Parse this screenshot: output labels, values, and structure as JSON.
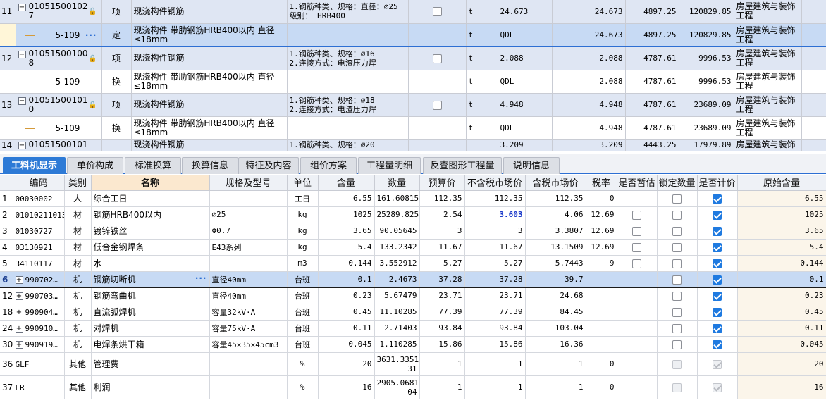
{
  "top_rows": [
    {
      "num": "11",
      "type": "parent",
      "code": "01051500102",
      "code2": "7",
      "kind": "项",
      "name": "现浇构件钢筋",
      "name2": "",
      "feat1": "1.钢筋种类、规格：直径：⌀25",
      "feat2": "级别： HRB400",
      "unit": "t",
      "expr": "24.673",
      "qty": "24.673",
      "price": "4897.25",
      "total": "120829.85",
      "prof1": "房屋建筑与装饰",
      "prof2": "工程"
    },
    {
      "num": "",
      "type": "child",
      "selected": true,
      "code": "5-109",
      "kind": "定",
      "name": "现浇构件 带肋钢筋HRB400以内 直径",
      "name2": "≤18mm",
      "feat1": "",
      "feat2": "",
      "unit": "t",
      "expr": "QDL",
      "qty": "24.673",
      "price": "4897.25",
      "total": "120829.85",
      "prof1": "房屋建筑与装饰",
      "prof2": "工程"
    },
    {
      "num": "12",
      "type": "parent",
      "code": "01051500100",
      "code2": "8",
      "kind": "项",
      "name": "现浇构件钢筋",
      "name2": "",
      "feat1": "1.钢筋种类、规格：⌀16",
      "feat2": "2.连接方式：电渣压力焊",
      "unit": "t",
      "expr": "2.088",
      "qty": "2.088",
      "price": "4787.61",
      "total": "9996.53",
      "prof1": "房屋建筑与装饰",
      "prof2": "工程"
    },
    {
      "num": "",
      "type": "child",
      "code": "5-109",
      "kind": "换",
      "name": "现浇构件 带肋钢筋HRB400以内 直径",
      "name2": "≤18mm",
      "feat1": "",
      "feat2": "",
      "unit": "t",
      "expr": "QDL",
      "qty": "2.088",
      "price": "4787.61",
      "total": "9996.53",
      "prof1": "房屋建筑与装饰",
      "prof2": "工程"
    },
    {
      "num": "13",
      "type": "parent",
      "code": "01051500101",
      "code2": "0",
      "kind": "项",
      "name": "现浇构件钢筋",
      "name2": "",
      "feat1": "1.钢筋种类、规格：⌀18",
      "feat2": "2.连接方式：电渣压力焊",
      "unit": "t",
      "expr": "4.948",
      "qty": "4.948",
      "price": "4787.61",
      "total": "23689.09",
      "prof1": "房屋建筑与装饰",
      "prof2": "工程"
    },
    {
      "num": "",
      "type": "child",
      "code": "5-109",
      "kind": "换",
      "name": "现浇构件 带肋钢筋HRB400以内 直径",
      "name2": "≤18mm",
      "feat1": "",
      "feat2": "",
      "unit": "t",
      "expr": "QDL",
      "qty": "4.948",
      "price": "4787.61",
      "total": "23689.09",
      "prof1": "房屋建筑与装饰",
      "prof2": "工程"
    },
    {
      "num": "14",
      "type": "parent",
      "partial": true,
      "code": "01051500101",
      "code2": "",
      "kind": "",
      "name": "现浇构件钢筋",
      "name2": "",
      "feat1": "1.钢筋种类、规格：⌀20",
      "feat2": "",
      "unit": "",
      "expr": "3.209",
      "qty": "3.209",
      "price": "4443.25",
      "total": "17979.89",
      "prof1": "房屋建筑与装饰",
      "prof2": ""
    }
  ],
  "tabs": [
    {
      "label": "工料机显示",
      "active": true
    },
    {
      "label": "单价构成"
    },
    {
      "label": "标准换算"
    },
    {
      "label": "换算信息"
    },
    {
      "label": "特征及内容"
    },
    {
      "label": "组价方案"
    },
    {
      "label": "工程量明细"
    },
    {
      "label": "反查图形工程量"
    },
    {
      "label": "说明信息"
    }
  ],
  "columns": [
    "",
    "编码",
    "类别",
    "名称",
    "规格及型号",
    "单位",
    "含量",
    "数量",
    "预算价",
    "不含税市场价",
    "含税市场价",
    "税率",
    "是否暂估",
    "锁定数量",
    "是否计价",
    "原始含量"
  ],
  "materials": [
    {
      "rn": "1",
      "code": "00030002",
      "cat": "人",
      "name": "综合工日",
      "spec": "",
      "unit": "工日",
      "content": "6.55",
      "qty": "161.60815",
      "budget": "112.35",
      "market": "112.35",
      "tax_market": "112.35",
      "rate": "0",
      "est": "none",
      "lock": "box",
      "priced": "checked",
      "orig": "6.55"
    },
    {
      "rn": "2",
      "code": "01010211013",
      "cat": "材",
      "name": "钢筋HRB400以内",
      "spec": "⌀25",
      "unit": "kg",
      "content": "1025",
      "qty": "25289.825",
      "budget": "2.54",
      "market": "3.603",
      "market_blue": true,
      "tax_market": "4.06",
      "rate": "12.69",
      "est": "box",
      "lock": "box",
      "priced": "checked",
      "orig": "1025"
    },
    {
      "rn": "3",
      "code": "01030727",
      "cat": "材",
      "name": "镀锌铁丝",
      "spec": "Φ0.7",
      "unit": "kg",
      "content": "3.65",
      "qty": "90.05645",
      "budget": "3",
      "market": "3",
      "tax_market": "3.3807",
      "rate": "12.69",
      "est": "box",
      "lock": "box",
      "priced": "checked",
      "orig": "3.65"
    },
    {
      "rn": "4",
      "code": "03130921",
      "cat": "材",
      "name": "低合金钢焊条",
      "spec": "E43系列",
      "unit": "kg",
      "content": "5.4",
      "qty": "133.2342",
      "budget": "11.67",
      "market": "11.67",
      "tax_market": "13.1509",
      "rate": "12.69",
      "est": "box",
      "lock": "box",
      "priced": "checked",
      "orig": "5.4"
    },
    {
      "rn": "5",
      "code": "34110117",
      "cat": "材",
      "name": "水",
      "spec": "",
      "unit": "m3",
      "content": "0.144",
      "qty": "3.552912",
      "budget": "5.27",
      "market": "5.27",
      "tax_market": "5.7443",
      "rate": "9",
      "est": "box",
      "lock": "box",
      "priced": "checked",
      "orig": "0.144"
    },
    {
      "rn": "6",
      "code": "990702…",
      "expand": true,
      "selected": true,
      "cat": "机",
      "name": "钢筋切断机",
      "spec": "直径40mm",
      "unit": "台班",
      "content": "0.1",
      "qty": "2.4673",
      "budget": "37.28",
      "market": "37.28",
      "tax_market": "39.7",
      "rate": "",
      "est": "none",
      "lock": "box",
      "priced": "checked",
      "orig": "0.1"
    },
    {
      "rn": "12",
      "code": "990703…",
      "expand": true,
      "cat": "机",
      "name": "钢筋弯曲机",
      "spec": "直径40mm",
      "unit": "台班",
      "content": "0.23",
      "qty": "5.67479",
      "budget": "23.71",
      "market": "23.71",
      "tax_market": "24.68",
      "rate": "",
      "est": "none",
      "lock": "box",
      "priced": "checked",
      "orig": "0.23"
    },
    {
      "rn": "18",
      "code": "990904…",
      "expand": true,
      "cat": "机",
      "name": "直流弧焊机",
      "spec": "容量32kV·A",
      "unit": "台班",
      "content": "0.45",
      "qty": "11.10285",
      "budget": "77.39",
      "market": "77.39",
      "tax_market": "84.45",
      "rate": "",
      "est": "none",
      "lock": "box",
      "priced": "checked",
      "orig": "0.45"
    },
    {
      "rn": "24",
      "code": "990910…",
      "expand": true,
      "cat": "机",
      "name": "对焊机",
      "spec": "容量75kV·A",
      "unit": "台班",
      "content": "0.11",
      "qty": "2.71403",
      "budget": "93.84",
      "market": "93.84",
      "tax_market": "103.04",
      "rate": "",
      "est": "none",
      "lock": "box",
      "priced": "checked",
      "orig": "0.11"
    },
    {
      "rn": "30",
      "code": "990919…",
      "expand": true,
      "cat": "机",
      "name": "电焊条烘干箱",
      "spec": "容量45×35×45cm3",
      "unit": "台班",
      "content": "0.045",
      "qty": "1.110285",
      "budget": "15.86",
      "market": "15.86",
      "tax_market": "16.36",
      "rate": "",
      "est": "none",
      "lock": "box",
      "priced": "checked",
      "orig": "0.045"
    },
    {
      "rn": "36",
      "code": "GLF",
      "cat": "其他",
      "name": "管理费",
      "spec": "",
      "unit": "%",
      "content": "20",
      "qty": "3631.3351",
      "qty2": "31",
      "budget": "1",
      "market": "1",
      "tax_market": "1",
      "rate": "0",
      "est": "none",
      "lock": "disabled",
      "priced": "disabled-checked",
      "orig": "20",
      "tall": true
    },
    {
      "rn": "37",
      "code": "LR",
      "cat": "其他",
      "name": "利润",
      "spec": "",
      "unit": "%",
      "content": "16",
      "qty": "2905.0681",
      "qty2": "04",
      "budget": "1",
      "market": "1",
      "tax_market": "1",
      "rate": "0",
      "est": "none",
      "lock": "disabled",
      "priced": "disabled-checked",
      "orig": "16",
      "tall": true
    }
  ]
}
